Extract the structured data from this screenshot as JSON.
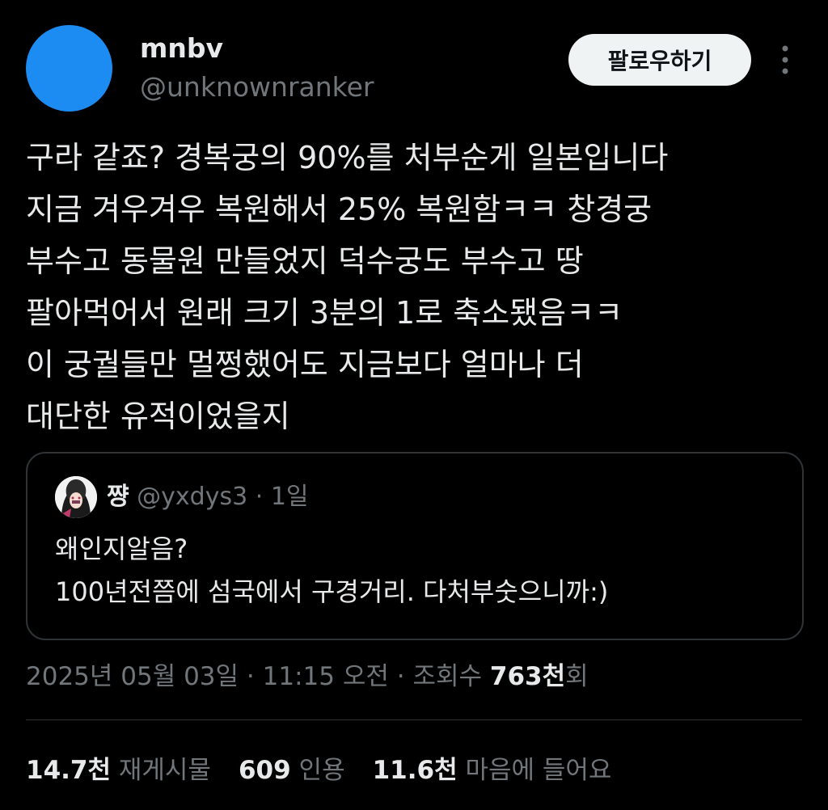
{
  "author": {
    "display_name": "mnbv",
    "handle": "@unknownranker",
    "avatar_color": "#1d8cf2"
  },
  "follow_button_label": "팔로우하기",
  "more_icon": "vertical-ellipsis-icon",
  "tweet": {
    "lines": [
      "구라 같죠? 경복궁의 90%를 처부순게 일본입니다",
      "지금 겨우겨우 복원해서 25% 복원함ㅋㅋ 창경궁",
      "부수고 동물원 만들었지 덕수궁도 부수고 땅",
      "팔아먹어서 원래 크기 3분의 1로 축소됐음ㅋㅋ",
      "이 궁궐들만 멀쩡했어도 지금보다 얼마나 더",
      "대단한 유적이었을지"
    ]
  },
  "quote": {
    "name": "쨩",
    "handle": "@yxdys3",
    "separator": "·",
    "time": "1일",
    "lines": [
      "왜인지알음?",
      "100년전쯤에 섬국에서 구경거리. 다처부숫으니까:)"
    ]
  },
  "meta": {
    "date": "2025년 05월 03일",
    "time": "11:15 오전",
    "views_label": "조회수",
    "views_count": "763천",
    "views_suffix": "회"
  },
  "stats": {
    "reposts_count": "14.7천",
    "reposts_label": "재게시물",
    "quotes_count": "609",
    "quotes_label": "인용",
    "likes_count": "11.6천",
    "likes_label": "마음에 들어요"
  },
  "colors": {
    "background": "#000000",
    "text_primary": "#e7e9ea",
    "text_secondary": "#71767b",
    "border": "#2f3336",
    "button_bg": "#eff3f4"
  }
}
